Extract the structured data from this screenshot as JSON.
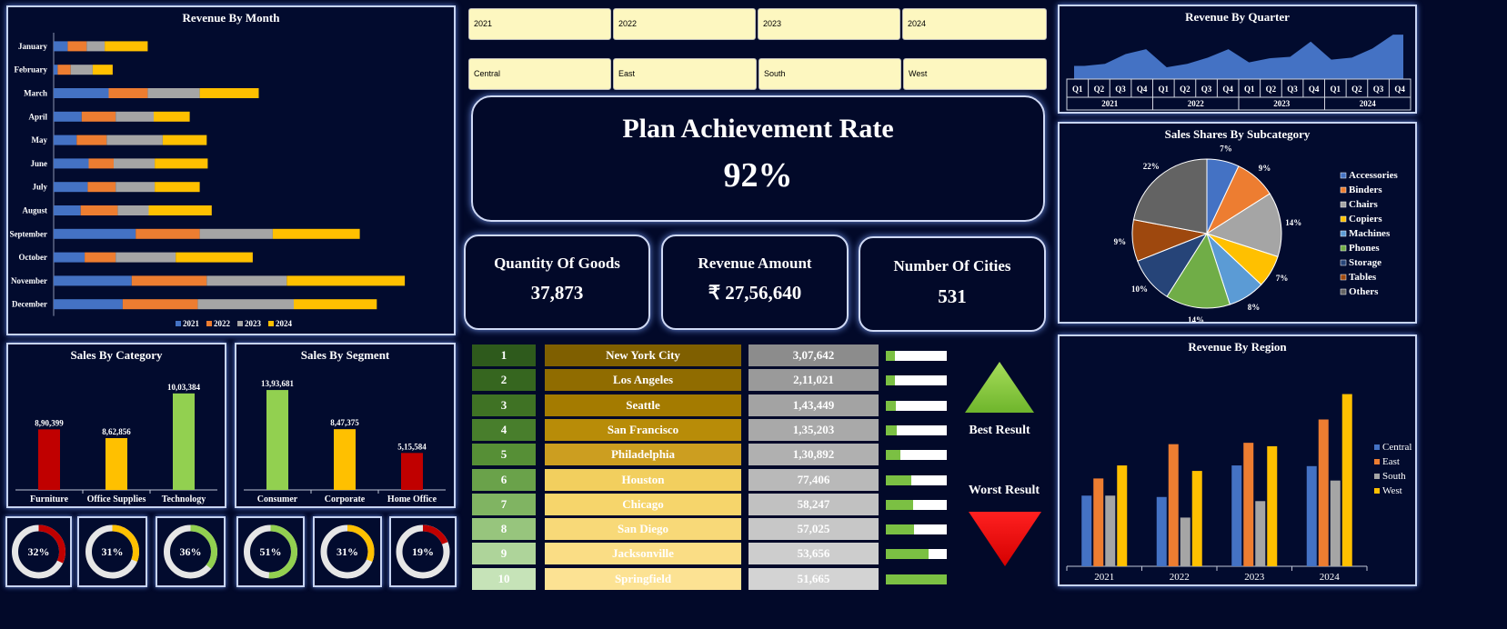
{
  "month_chart": {
    "title": "Revenue By Month",
    "legend": [
      "2021",
      "2022",
      "2023",
      "2024"
    ],
    "colors": [
      "#4472c4",
      "#ed7d31",
      "#a5a5a5",
      "#ffc000"
    ]
  },
  "quarter_chart": {
    "title": "Revenue By Quarter",
    "quarters": [
      "Q1",
      "Q2",
      "Q3",
      "Q4"
    ],
    "years": [
      "2021",
      "2022",
      "2023",
      "2024"
    ]
  },
  "subcat_chart": {
    "title": "Sales Shares By Subcategory"
  },
  "category_chart": {
    "title": "Sales By Category"
  },
  "segment_chart": {
    "title": "Sales By Segment"
  },
  "region_chart": {
    "title": "Revenue By Region"
  },
  "slicers": {
    "years": [
      "2021",
      "2022",
      "2023",
      "2024"
    ],
    "regions": [
      "Central",
      "East",
      "South",
      "West"
    ]
  },
  "plan": {
    "title": "Plan Achievement Rate",
    "value": "92%"
  },
  "kpis": [
    {
      "label": "Quantity Of Goods",
      "value": "37,873"
    },
    {
      "label": "Revenue Amount",
      "value": "₹ 27,56,640"
    },
    {
      "label": "Number Of Cities",
      "value": "531"
    }
  ],
  "ranking": [
    {
      "rank": "1",
      "city": "New York City",
      "value": "3,07,642",
      "pct": 0.15
    },
    {
      "rank": "2",
      "city": "Los Angeles",
      "value": "2,11,021",
      "pct": 0.15
    },
    {
      "rank": "3",
      "city": "Seattle",
      "value": "1,43,449",
      "pct": 0.17
    },
    {
      "rank": "4",
      "city": "San Francisco",
      "value": "1,35,203",
      "pct": 0.18
    },
    {
      "rank": "5",
      "city": "Philadelphia",
      "value": "1,30,892",
      "pct": 0.24
    },
    {
      "rank": "6",
      "city": "Houston",
      "value": "77,406",
      "pct": 0.42
    },
    {
      "rank": "7",
      "city": "Chicago",
      "value": "58,247",
      "pct": 0.45
    },
    {
      "rank": "8",
      "city": "San Diego",
      "value": "57,025",
      "pct": 0.47
    },
    {
      "rank": "9",
      "city": "Jacksonville",
      "value": "53,656",
      "pct": 0.7
    },
    {
      "rank": "10",
      "city": "Springfield",
      "value": "51,665",
      "pct": 1.0
    }
  ],
  "indicators": {
    "best": "Best Result",
    "worst": "Worst Result"
  },
  "donuts": [
    {
      "label": "32%",
      "value": 0.32,
      "color": "#c00000"
    },
    {
      "label": "31%",
      "value": 0.31,
      "color": "#ffc000"
    },
    {
      "label": "36%",
      "value": 0.36,
      "color": "#92d050"
    },
    {
      "label": "51%",
      "value": 0.51,
      "color": "#92d050"
    },
    {
      "label": "31%",
      "value": 0.31,
      "color": "#ffc000"
    },
    {
      "label": "19%",
      "value": 0.19,
      "color": "#c00000"
    }
  ],
  "chart_data": [
    {
      "type": "bar",
      "orientation": "horizontal-stacked",
      "title": "Revenue By Month",
      "categories": [
        "January",
        "February",
        "March",
        "April",
        "May",
        "June",
        "July",
        "August",
        "September",
        "October",
        "November",
        "December"
      ],
      "series": [
        {
          "name": "2021",
          "values": [
            14000,
            4000,
            55000,
            28000,
            23000,
            35000,
            34000,
            27000,
            82000,
            31000,
            78000,
            69000
          ]
        },
        {
          "name": "2022",
          "values": [
            19000,
            13000,
            39000,
            34000,
            30000,
            25000,
            28000,
            37000,
            64000,
            31000,
            75000,
            75000
          ]
        },
        {
          "name": "2023",
          "values": [
            18000,
            22000,
            52000,
            38000,
            56000,
            41000,
            39000,
            31000,
            73000,
            60000,
            80000,
            96000
          ]
        },
        {
          "name": "2024",
          "values": [
            43000,
            20000,
            59000,
            36000,
            44000,
            53000,
            45000,
            63000,
            87000,
            77000,
            118000,
            83000
          ]
        }
      ],
      "xlim": [
        0,
        380000
      ]
    },
    {
      "type": "area",
      "title": "Revenue By Quarter",
      "categories": [
        "2021 Q1",
        "2021 Q2",
        "2021 Q3",
        "2021 Q4",
        "2022 Q1",
        "2022 Q2",
        "2022 Q3",
        "2022 Q4",
        "2023 Q1",
        "2023 Q2",
        "2023 Q3",
        "2023 Q4",
        "2024 Q1",
        "2024 Q2",
        "2024 Q3",
        "2024 Q4"
      ],
      "values": [
        95000,
        110000,
        180000,
        215000,
        85000,
        110000,
        155000,
        215000,
        120000,
        150000,
        160000,
        270000,
        140000,
        155000,
        220000,
        320000
      ],
      "ylim": [
        0,
        360000
      ]
    },
    {
      "type": "pie",
      "title": "Sales Shares By Subcategory",
      "labels": [
        "Accessories",
        "Binders",
        "Chairs",
        "Copiers",
        "Machines",
        "Phones",
        "Storage",
        "Tables",
        "Others"
      ],
      "values": [
        7,
        9,
        14,
        7,
        8,
        14,
        10,
        9,
        22
      ],
      "colors": [
        "#4472c4",
        "#ed7d31",
        "#a5a5a5",
        "#ffc000",
        "#5b9bd5",
        "#70ad47",
        "#264478",
        "#9e480e",
        "#636363"
      ]
    },
    {
      "type": "bar",
      "title": "Sales By Category",
      "categories": [
        "Furniture",
        "Office Supplies",
        "Technology"
      ],
      "values": [
        890399,
        862856,
        1003384
      ],
      "labels": [
        "8,90,399",
        "8,62,856",
        "10,03,384"
      ],
      "colors": [
        "#c00000",
        "#ffc000",
        "#92d050"
      ],
      "ylim": [
        700000,
        1020000
      ]
    },
    {
      "type": "bar",
      "title": "Sales By Segment",
      "categories": [
        "Consumer",
        "Corporate",
        "Home Office"
      ],
      "values": [
        1393681,
        847375,
        515584
      ],
      "labels": [
        "13,93,681",
        "8,47,375",
        "5,15,584"
      ],
      "colors": [
        "#92d050",
        "#ffc000",
        "#c00000"
      ],
      "ylim": [
        0,
        1420000
      ]
    },
    {
      "type": "bar",
      "title": "Revenue By Region",
      "categories": [
        "2021",
        "2022",
        "2023",
        "2024"
      ],
      "series": [
        {
          "name": "Central",
          "values": [
            103000,
            101000,
            147000,
            146000
          ]
        },
        {
          "name": "East",
          "values": [
            128000,
            178000,
            180000,
            214000
          ]
        },
        {
          "name": "South",
          "values": [
            103000,
            71000,
            95000,
            125000
          ]
        },
        {
          "name": "West",
          "values": [
            147000,
            139000,
            175000,
            251000
          ]
        }
      ],
      "colors": [
        "#4472c4",
        "#ed7d31",
        "#a5a5a5",
        "#ffc000"
      ],
      "ylim": [
        0,
        265000
      ]
    }
  ]
}
